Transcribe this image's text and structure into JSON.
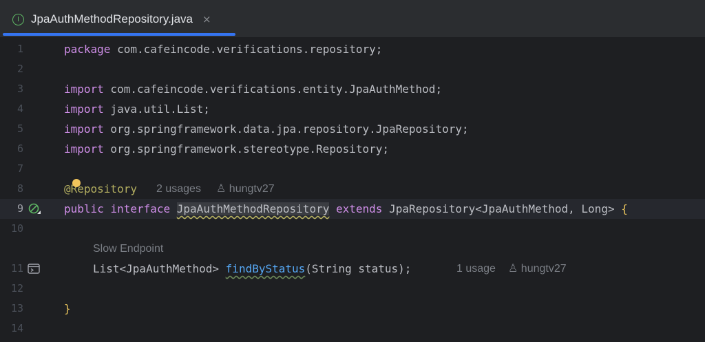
{
  "tab": {
    "filename": "JpaAuthMethodRepository.java",
    "close_icon": "×",
    "file_icon_glyph": "I"
  },
  "lines": [
    {
      "num": "1",
      "code": "package com.cafeincode.verifications.repository;"
    },
    {
      "num": "2",
      "code": ""
    },
    {
      "num": "3",
      "code": "import com.cafeincode.verifications.entity.JpaAuthMethod;"
    },
    {
      "num": "4",
      "code": "import java.util.List;"
    },
    {
      "num": "5",
      "code": "import org.springframework.data.jpa.repository.JpaRepository;"
    },
    {
      "num": "6",
      "code": "import org.springframework.stereotype.Repository;"
    },
    {
      "num": "7",
      "code": ""
    },
    {
      "num": "8",
      "code": "@Repository"
    },
    {
      "num": "9",
      "code": "public interface JpaAuthMethodRepository extends JpaRepository<JpaAuthMethod, Long> {"
    },
    {
      "num": "10",
      "code": ""
    },
    {
      "num": "11",
      "code": "    List<JpaAuthMethod> findByStatus(String status);"
    },
    {
      "num": "12",
      "code": ""
    },
    {
      "num": "13",
      "code": "}"
    },
    {
      "num": "14",
      "code": ""
    }
  ],
  "tokens": {
    "package_kw": "package",
    "package_name": " com.cafeincode.verifications.repository;",
    "import_kw": "import",
    "import_1": " com.cafeincode.verifications.entity.JpaAuthMethod;",
    "import_2": " java.util.List;",
    "import_3": " org.springframework.data.jpa.repository.JpaRepository;",
    "import_4": " org.springframework.stereotype.Repository;",
    "annotation": "@Repository",
    "public_kw": "public",
    "interface_kw": "interface",
    "interface_name": "JpaAuthMethodRepository",
    "extends_kw": "extends",
    "extends_type": "JpaRepository<JpaAuthMethod, Long>",
    "open_brace": "{",
    "return_type": "List<JpaAuthMethod>",
    "method_name": "findByStatus",
    "params": "(String status);",
    "close_brace": "}"
  },
  "inlays": {
    "annotation_usages": "2 usages",
    "annotation_author": "hungtv27",
    "method_group_label": "Slow Endpoint",
    "method_usages": "1 usage",
    "method_author": "hungtv27"
  },
  "icons": {
    "gutter_line9": "implemented-interface-icon",
    "gutter_line11": "endpoint-icon",
    "user_icon": "user-icon",
    "bulb": "intention-bulb-icon"
  }
}
